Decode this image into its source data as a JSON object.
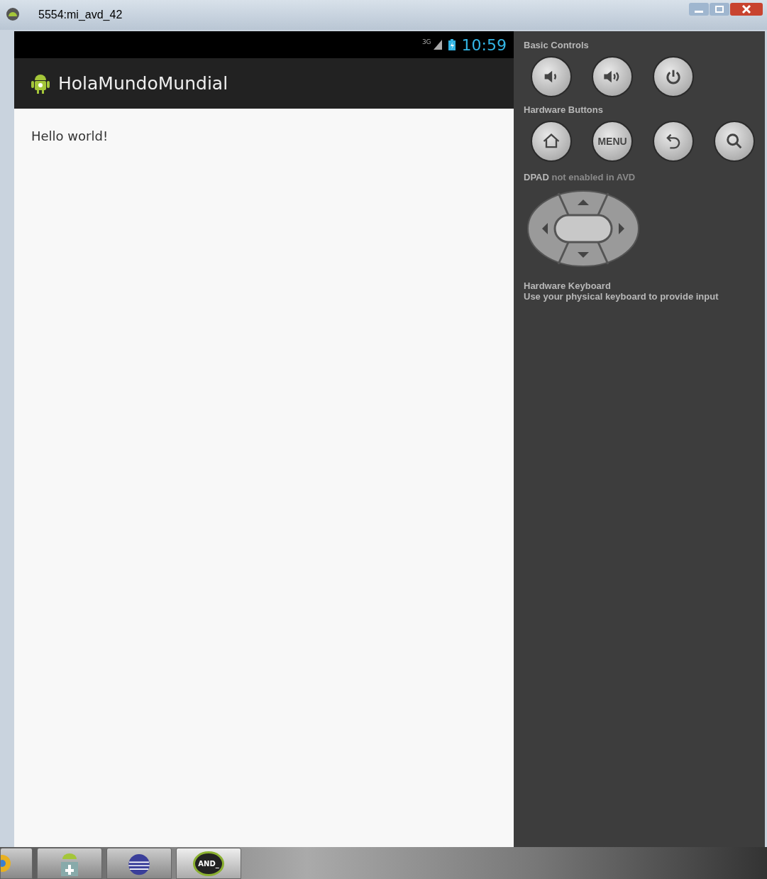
{
  "window": {
    "title": "5554:mi_avd_42"
  },
  "status_bar": {
    "network": "3G",
    "time": "10:59"
  },
  "action_bar": {
    "title": "HolaMundoMundial"
  },
  "content": {
    "text": "Hello world!"
  },
  "controls": {
    "basic_title": "Basic Controls",
    "hardware_title": "Hardware Buttons",
    "menu_label": "MENU",
    "dpad_title": "**DPAD** not enabled in AVD",
    "keyboard_title": "Hardware Keyboard",
    "keyboard_text": "Use your physical keyboard to provide input"
  },
  "taskbar": {
    "items": [
      {
        "kind": "browser",
        "selected": false
      },
      {
        "kind": "installer",
        "selected": false
      },
      {
        "kind": "ide",
        "selected": false
      },
      {
        "kind": "emulator",
        "label": "AND_",
        "selected": true
      }
    ]
  }
}
